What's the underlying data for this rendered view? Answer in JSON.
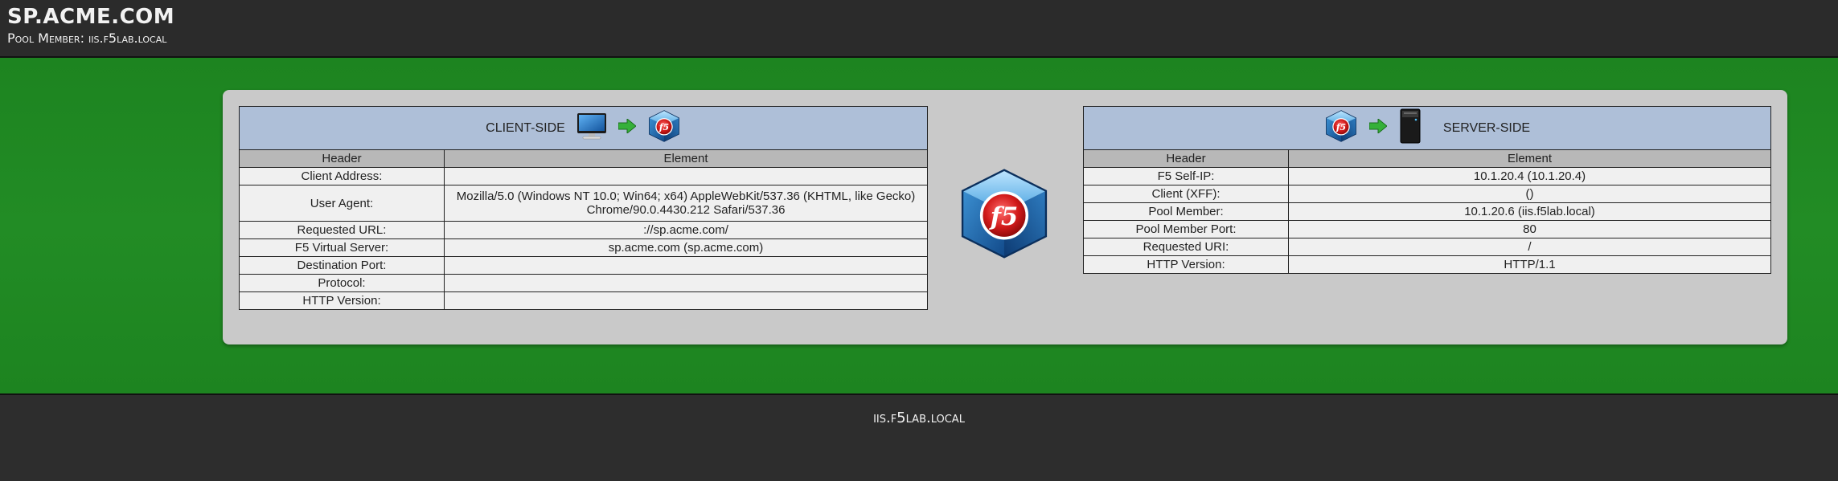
{
  "header": {
    "site_title": "SP.ACME.COM",
    "pool_member_line": "Pool Member: iis.f5lab.local"
  },
  "client_side": {
    "title": "CLIENT-SIDE",
    "col_header": "Header",
    "col_element": "Element",
    "icons": [
      "monitor-icon",
      "green-arrow-icon",
      "f5-logo-icon"
    ],
    "rows": [
      {
        "header": "Client Address:",
        "element": ""
      },
      {
        "header": "User Agent:",
        "element": "Mozilla/5.0 (Windows NT 10.0; Win64; x64) AppleWebKit/537.36 (KHTML, like Gecko) Chrome/90.0.4430.212 Safari/537.36"
      },
      {
        "header": "Requested URL:",
        "element": "://sp.acme.com/"
      },
      {
        "header": "F5 Virtual Server:",
        "element": "sp.acme.com (sp.acme.com)"
      },
      {
        "header": "Destination Port:",
        "element": ""
      },
      {
        "header": "Protocol:",
        "element": ""
      },
      {
        "header": "HTTP Version:",
        "element": ""
      }
    ]
  },
  "server_side": {
    "title": "SERVER-SIDE",
    "col_header": "Header",
    "col_element": "Element",
    "icons": [
      "f5-logo-icon",
      "green-arrow-icon",
      "server-tower-icon"
    ],
    "rows": [
      {
        "header": "F5 Self-IP:",
        "element": "10.1.20.4 (10.1.20.4)"
      },
      {
        "header": "Client (XFF):",
        "element": "()"
      },
      {
        "header": "Pool Member:",
        "element": "10.1.20.6 (iis.f5lab.local)"
      },
      {
        "header": "Pool Member Port:",
        "element": "80"
      },
      {
        "header": "Requested URI:",
        "element": "/"
      },
      {
        "header": "HTTP Version:",
        "element": "HTTP/1.1"
      }
    ]
  },
  "footer": {
    "text": "iis.f5lab.local"
  },
  "colors": {
    "topbar": "#2b2b2b",
    "background_green": "#1f8a22",
    "panel": "#c9c9c9",
    "table_caption": "#aebfd8",
    "table_column_header": "#b8b8b8",
    "table_cell": "#f0f0f0"
  }
}
